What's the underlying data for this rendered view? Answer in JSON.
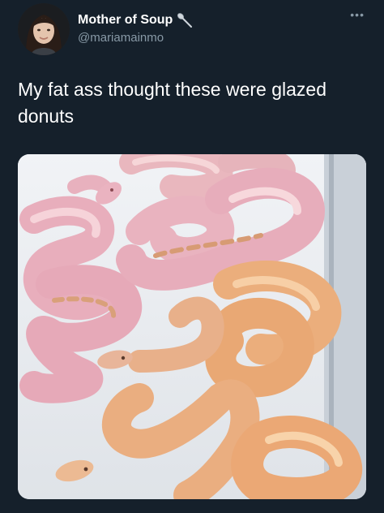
{
  "tweet": {
    "display_name": "Mother of Soup",
    "name_emoji": "spoon-icon",
    "handle": "@mariamainmo",
    "more_label": "•••",
    "text": "My fat ass thought these were glazed donuts"
  },
  "media": {
    "subject": "snakes-photo"
  },
  "colors": {
    "background": "#15202b",
    "text_primary": "#ffffff",
    "text_secondary": "#8899a6"
  }
}
